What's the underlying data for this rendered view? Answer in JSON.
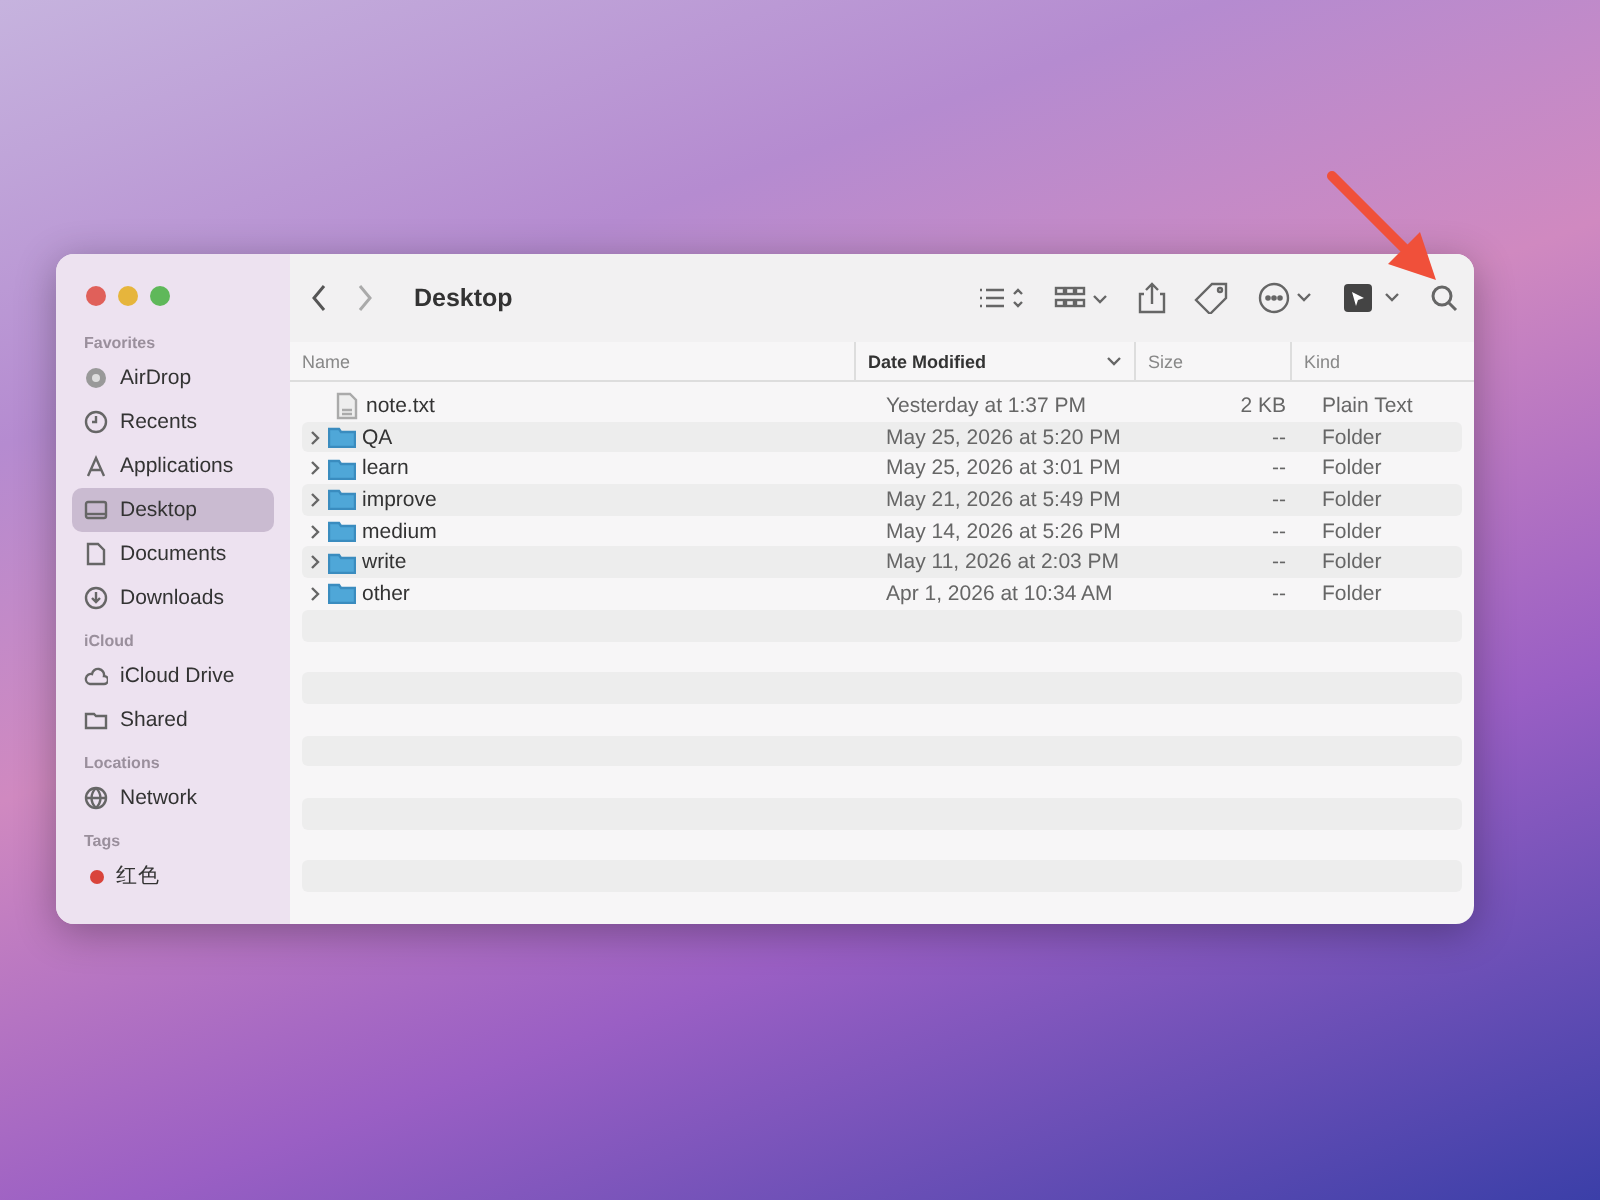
{
  "window": {
    "title": "Desktop"
  },
  "sidebar": {
    "sections": [
      {
        "heading": "Favorites",
        "items": [
          {
            "label": "AirDrop",
            "kind": "airdrop",
            "selected": false
          },
          {
            "label": "Recents",
            "kind": "clock",
            "selected": false
          },
          {
            "label": "Applications",
            "kind": "apps",
            "selected": false
          },
          {
            "label": "Desktop",
            "kind": "desktop",
            "selected": true
          },
          {
            "label": "Documents",
            "kind": "document",
            "selected": false
          },
          {
            "label": "Downloads",
            "kind": "download",
            "selected": false
          }
        ]
      },
      {
        "heading": "iCloud",
        "items": [
          {
            "label": "iCloud Drive",
            "kind": "cloud",
            "selected": false
          },
          {
            "label": "Shared",
            "kind": "shared",
            "selected": false
          }
        ]
      },
      {
        "heading": "Locations",
        "items": [
          {
            "label": "Network",
            "kind": "globe",
            "selected": false
          }
        ]
      },
      {
        "heading": "Tags",
        "items": [
          {
            "label": "红色",
            "kind": "tag",
            "color": "#d9443b",
            "selected": false
          }
        ]
      }
    ]
  },
  "table": {
    "columns": [
      {
        "label": "Name",
        "sorted": false
      },
      {
        "label": "Date Modified",
        "sorted": true
      },
      {
        "label": "Size",
        "sorted": false
      },
      {
        "label": "Kind",
        "sorted": false
      }
    ],
    "rows": [
      {
        "kind": "file",
        "name": "note.txt",
        "date": "Yesterday at 1:37 PM",
        "size": "2 KB",
        "type": "Plain Text"
      },
      {
        "kind": "folder",
        "name": "QA",
        "date": "May 25, 2026 at 5:20 PM",
        "size": "--",
        "type": "Folder"
      },
      {
        "kind": "folder",
        "name": "learn",
        "date": "May 25, 2026 at 3:01 PM",
        "size": "--",
        "type": "Folder"
      },
      {
        "kind": "folder",
        "name": "improve",
        "date": "May 21, 2026 at 5:49 PM",
        "size": "--",
        "type": "Folder"
      },
      {
        "kind": "folder",
        "name": "medium",
        "date": "May 14, 2026 at 5:26 PM",
        "size": "--",
        "type": "Folder"
      },
      {
        "kind": "folder",
        "name": "write",
        "date": "May 11, 2026 at 2:03 PM",
        "size": "--",
        "type": "Folder"
      },
      {
        "kind": "folder",
        "name": "other",
        "date": "Apr 1, 2026 at 10:34 AM",
        "size": "--",
        "type": "Folder"
      }
    ]
  }
}
